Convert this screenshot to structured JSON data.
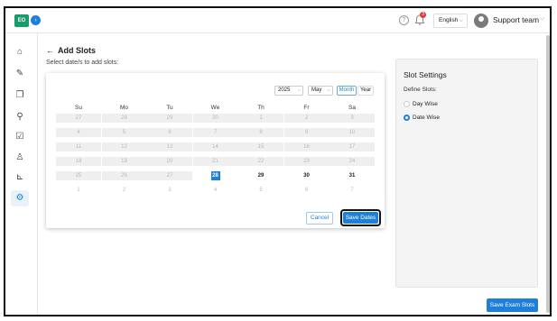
{
  "header": {
    "logo_text": "EO",
    "language": "English",
    "user_name": "Support team",
    "notification_count": "3"
  },
  "page": {
    "back_arrow": "←",
    "title": "Add Slots",
    "subtitle": "Select date/s to add slots:"
  },
  "calendar": {
    "year": "2025",
    "month": "May",
    "view_month": "Month",
    "view_year": "Year",
    "weekdays": [
      "Su",
      "Mo",
      "Tu",
      "We",
      "Th",
      "Fr",
      "Sa"
    ],
    "weeks": [
      [
        "27",
        "28",
        "29",
        "30",
        "1",
        "2",
        "3"
      ],
      [
        "4",
        "5",
        "6",
        "7",
        "8",
        "9",
        "10"
      ],
      [
        "11",
        "12",
        "13",
        "14",
        "15",
        "16",
        "17"
      ],
      [
        "18",
        "19",
        "20",
        "21",
        "22",
        "23",
        "24"
      ],
      [
        "25",
        "26",
        "27",
        "28",
        "29",
        "30",
        "31"
      ],
      [
        "1",
        "2",
        "3",
        "4",
        "5",
        "6",
        "7"
      ]
    ],
    "today": "28",
    "cancel_label": "Cancel",
    "save_label": "Save Dates"
  },
  "slot_settings": {
    "title": "Slot Settings",
    "define_label": "Define Slots:",
    "options": [
      "Day Wise",
      "Date Wise"
    ],
    "selected": "Date Wise"
  },
  "footer": {
    "save_exam_label": "Save Exam Slots"
  },
  "colors": {
    "accent": "#1e7fd8",
    "logo": "#1a9b6a",
    "badge": "#e23a3a"
  }
}
